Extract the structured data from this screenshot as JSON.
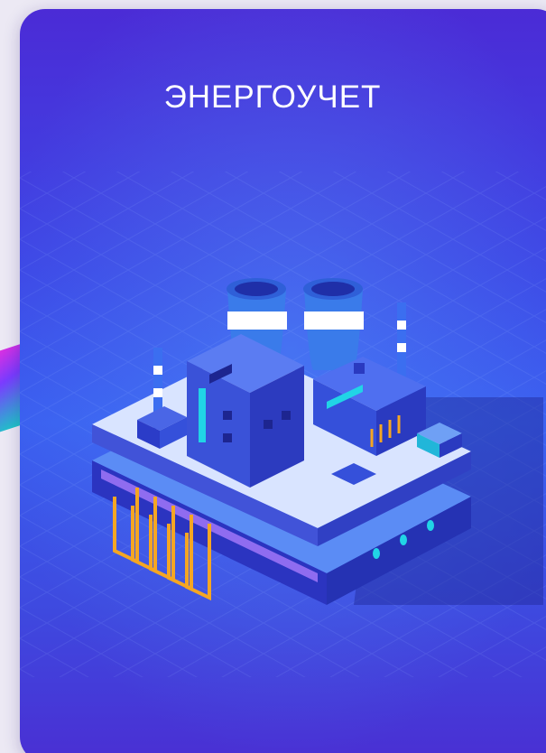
{
  "card": {
    "title": "ЭНЕРГОУЧЕТ"
  },
  "colors": {
    "card_top": "#4b2bd6",
    "card_mid": "#3a5ff0",
    "platform": "#2f3bd0",
    "building": "#3b51d6",
    "accent_cyan": "#21d4e6",
    "pipes_orange": "#f5a623",
    "chimney_white": "#ffffff"
  },
  "illustration": {
    "icon": "power-plant-isometric-icon"
  }
}
